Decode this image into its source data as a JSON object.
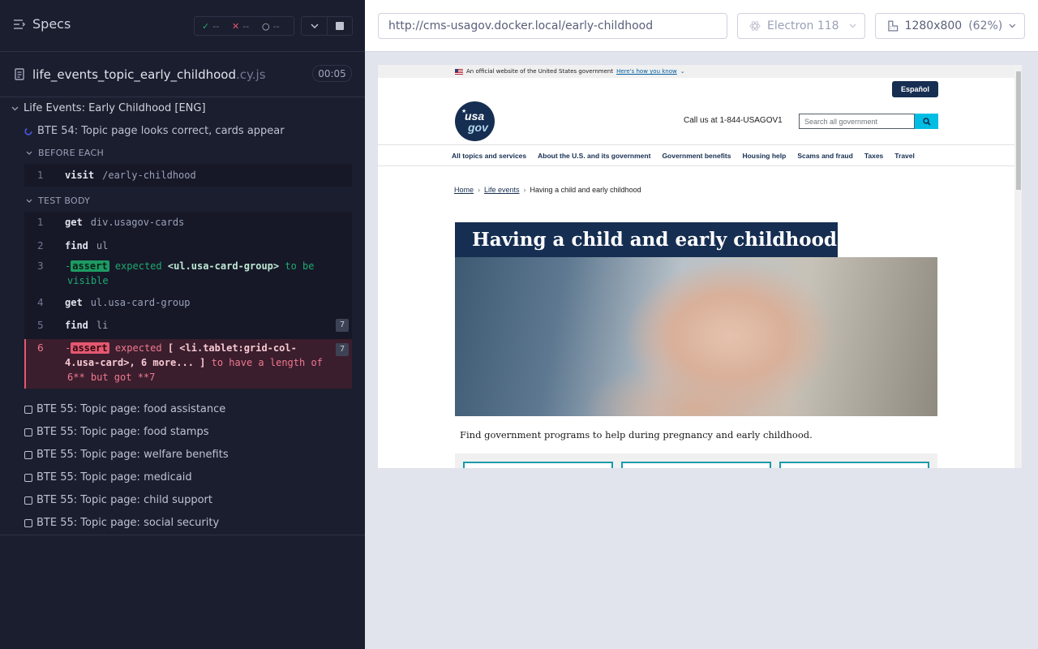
{
  "reporter": {
    "title": "Specs",
    "stats": {
      "passed": "--",
      "failed": "--",
      "pending": "--"
    },
    "spec": {
      "name": "life_events_topic_early_childhood",
      "ext": ".cy.js",
      "duration": "00:05"
    },
    "suite": "Life Events: Early Childhood [ENG]",
    "active_test": "BTE 54: Topic page looks correct, cards appear",
    "before_each_label": "BEFORE EACH",
    "before_each": [
      {
        "num": "1",
        "name": "visit",
        "msg": "/early-childhood"
      }
    ],
    "test_body_label": "TEST BODY",
    "commands": [
      {
        "num": "1",
        "name": "get",
        "msg": "div.usagov-cards"
      },
      {
        "num": "2",
        "name": "find",
        "msg": "ul"
      },
      {
        "num": "3",
        "tag": "assert",
        "prefix": "-",
        "expected": "expected",
        "target": "<ul.usa-card-group>",
        "rest": "to be",
        "rest2": "visible"
      },
      {
        "num": "4",
        "name": "get",
        "msg": "ul.usa-card-group"
      },
      {
        "num": "5",
        "name": "find",
        "msg": "li",
        "count": "7"
      },
      {
        "num": "6",
        "tag": "assert",
        "prefix": "-",
        "expected": "expected",
        "target": "[ <li.tablet:grid-col-",
        "line2": "4.usa-card>, 6 more... ]",
        "rest": "to have a length of",
        "line3": "6** but got **7",
        "count": "7"
      }
    ],
    "queued_tests": [
      "BTE 55: Topic page: food assistance",
      "BTE 55: Topic page: food stamps",
      "BTE 55: Topic page: welfare benefits",
      "BTE 55: Topic page: medicaid",
      "BTE 55: Topic page: child support",
      "BTE 55: Topic page: social security"
    ]
  },
  "app": {
    "url": "http://cms-usagov.docker.local/early-childhood",
    "browser": "Electron 118",
    "viewport": "1280x800",
    "zoom": "(62%)",
    "site": {
      "banner_text": "An official website of the United States government",
      "banner_link": "Here's how you know",
      "espanol": "Español",
      "logo_line1": "usa",
      "logo_line2": "gov",
      "call_us": "Call us at 1-844-USAGOV1",
      "search_placeholder": "Search all government",
      "nav": [
        "All topics and services",
        "About the U.S. and its government",
        "Government benefits",
        "Housing help",
        "Scams and fraud",
        "Taxes",
        "Travel"
      ],
      "breadcrumb": {
        "home": "Home",
        "life_events": "Life events",
        "current": "Having a child and early childhood"
      },
      "page_title": "Having a child and early childhood",
      "intro": "Find government programs to help during pregnancy and early childhood."
    }
  },
  "colors": {
    "pass": "#1fa971",
    "fail": "#e45770",
    "navy": "#162e51",
    "cyan": "#00bde3"
  }
}
